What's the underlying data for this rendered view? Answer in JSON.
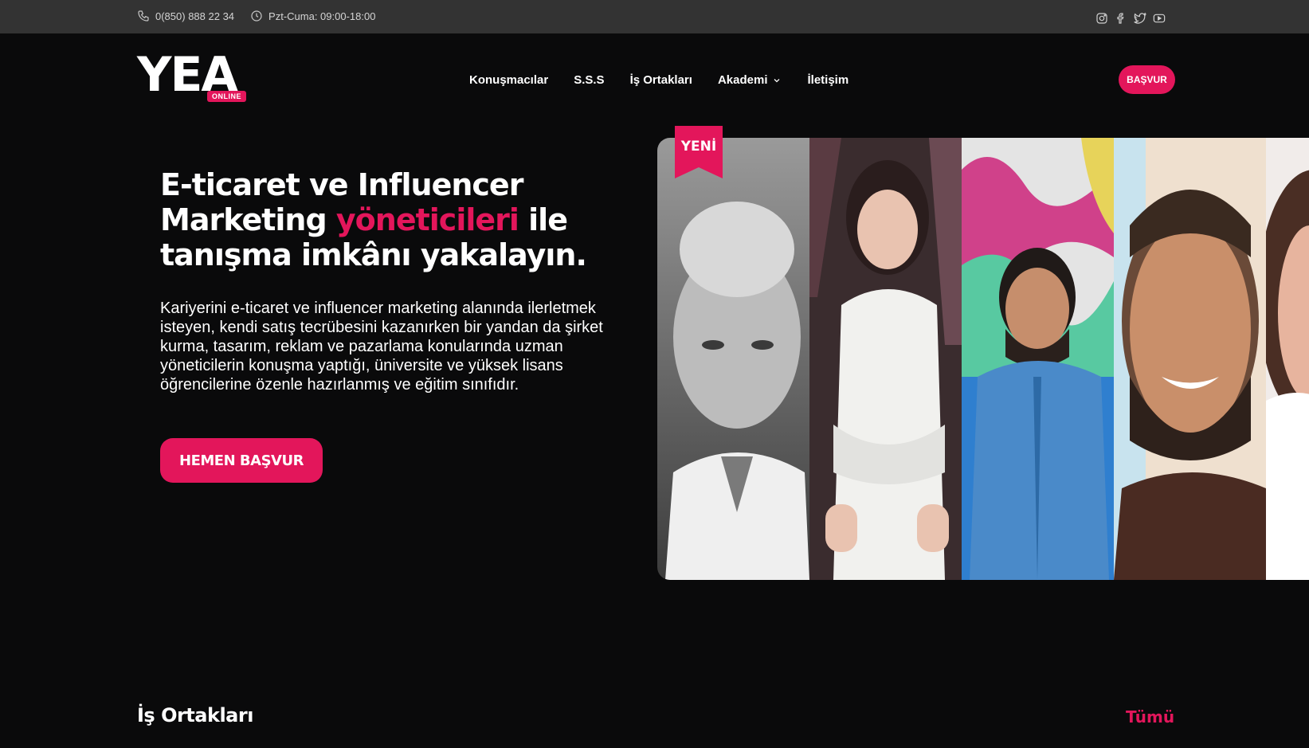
{
  "topbar": {
    "phone": "0(850) 888 22 34",
    "hours": "Pzt-Cuma: 09:00-18:00",
    "social_icons": [
      "instagram-icon",
      "facebook-icon",
      "twitter-icon",
      "youtube-icon"
    ]
  },
  "header": {
    "logo_text": "YEA",
    "logo_badge": "ONLINE",
    "nav": [
      {
        "label": "Konuşmacılar"
      },
      {
        "label": "S.S.S"
      },
      {
        "label": "İş Ortakları"
      },
      {
        "label": "Akademi",
        "has_dropdown": true
      },
      {
        "label": "İletişim"
      }
    ],
    "apply_label": "BAŞVUR"
  },
  "hero": {
    "title_part1": "E-ticaret ve Influencer Marketing ",
    "title_accent": "yöneticileri",
    "title_part2": " ile tanışma imkânı yakalayın.",
    "description": "Kariyerini e-ticaret ve influencer marketing alanında ilerletmek isteyen, kendi satış tecrübesini kazanırken bir yandan da şirket kurma, tasarım, reklam ve pazarlama konularında uzman yöneticilerin konuşma yaptığı, üniversite ve yüksek lisans öğrencilerine özenle hazırlanmış ve eğitim sınıfıdır.",
    "cta_label": "HEMEN BAŞVUR",
    "badge": "YENİ"
  },
  "partners": {
    "title": "İş Ortakları",
    "all_label": "Tümü"
  },
  "colors": {
    "accent": "#e3165b",
    "topbar_bg": "#333333",
    "page_bg": "#0a0a0b"
  }
}
